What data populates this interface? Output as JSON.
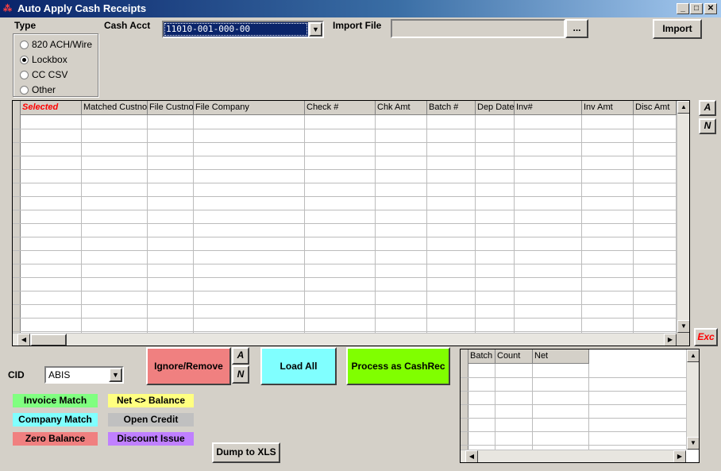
{
  "window": {
    "title": "Auto Apply Cash Receipts",
    "icon": "app-icon"
  },
  "type_group": {
    "label": "Type",
    "options": [
      {
        "label": "820 ACH/Wire",
        "selected": false
      },
      {
        "label": "Lockbox",
        "selected": true
      },
      {
        "label": "CC CSV",
        "selected": false
      },
      {
        "label": "Other",
        "selected": false
      }
    ]
  },
  "cash_acct": {
    "label": "Cash Acct",
    "value": "11010-001-000-00"
  },
  "import_file": {
    "label": "Import File",
    "value": "",
    "browse_label": "...",
    "import_label": "Import"
  },
  "main_grid": {
    "columns": [
      "Selected",
      "Matched Custno",
      "File Custno",
      "File Company",
      "Check #",
      "Chk Amt",
      "Batch #",
      "Dep Date",
      "Inv#",
      "Inv Amt",
      "Disc Amt"
    ],
    "row_count": 16
  },
  "side_buttons": {
    "a_label": "A",
    "n_label": "N",
    "exc_label": "Exc"
  },
  "cid": {
    "label": "CID",
    "value": "ABIS"
  },
  "actions": {
    "ignore_remove": "Ignore/Remove",
    "a_label": "A",
    "n_label": "N",
    "load_all": "Load All",
    "process": "Process as CashRec",
    "dump_xls": "Dump to XLS"
  },
  "legend": {
    "invoice_match": "Invoice Match",
    "net_balance": "Net <> Balance",
    "company_match": "Company Match",
    "open_credit": "Open Credit",
    "zero_balance": "Zero Balance",
    "discount_issue": "Discount Issue"
  },
  "colors": {
    "ignore": "#f08080",
    "load_all": "#80ffff",
    "process": "#80ff00",
    "invoice_match": "#80ff80",
    "net_balance": "#ffff80",
    "company_match": "#80ffff",
    "open_credit": "#c0c0c0",
    "zero_balance": "#f08080",
    "discount_issue": "#c080ff",
    "selected_header": "#ff0000",
    "exc": "#ff0000"
  },
  "batch_grid": {
    "columns": [
      "Batch",
      "Count",
      "Net"
    ],
    "row_count": 6
  }
}
